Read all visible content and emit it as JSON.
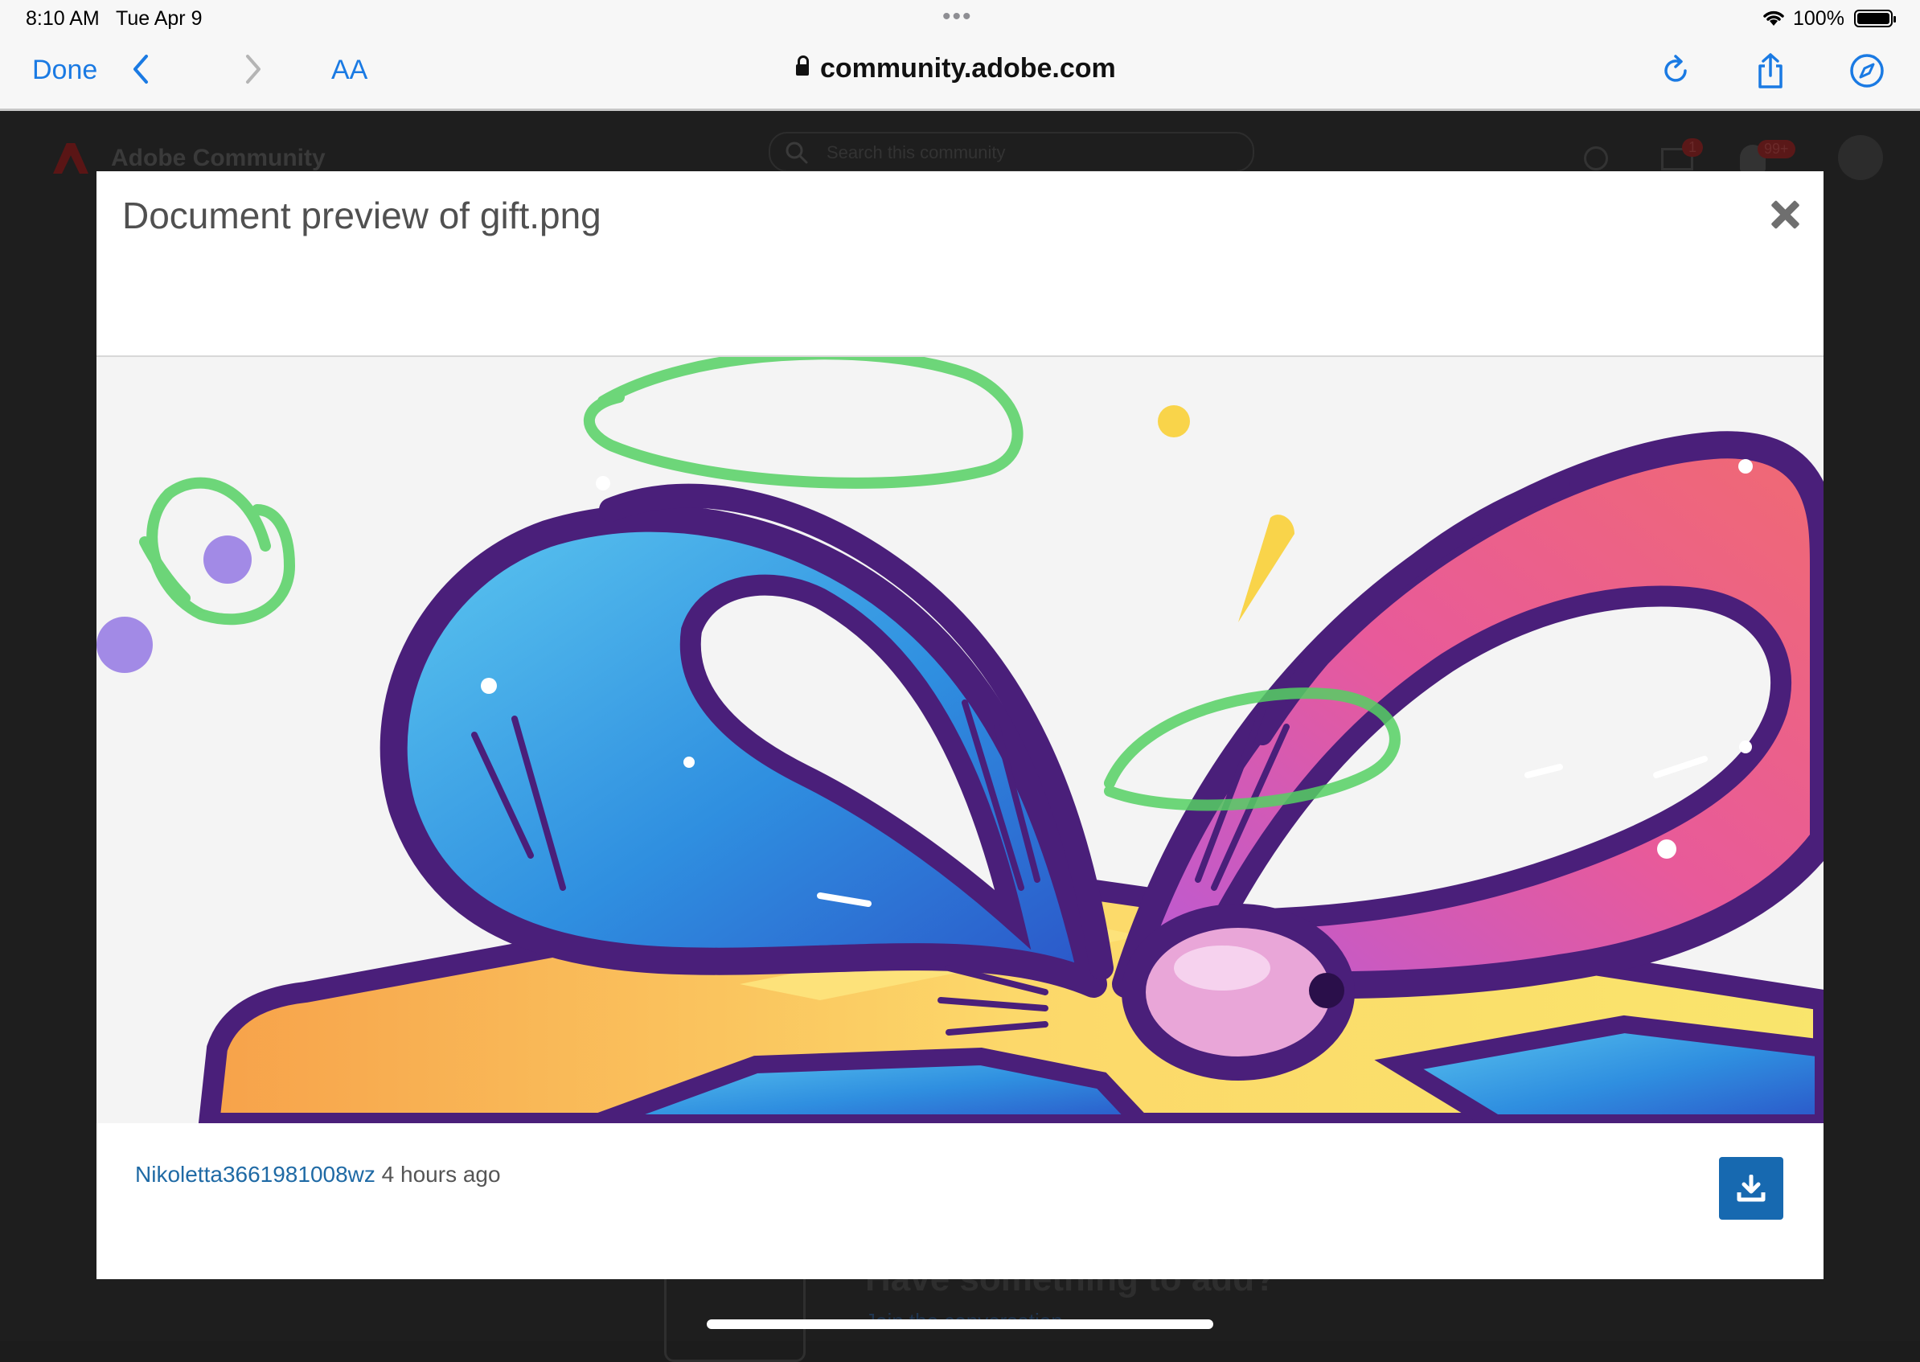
{
  "status_bar": {
    "time": "8:10 AM",
    "date": "Tue Apr 9",
    "battery": "100%"
  },
  "toolbar": {
    "done_label": "Done",
    "text_size_label": "AA",
    "url": "community.adobe.com",
    "icons": [
      "back-icon",
      "forward-icon",
      "reload-icon",
      "share-icon",
      "compass-icon"
    ]
  },
  "background_page": {
    "site_title": "Adobe Community",
    "search_placeholder": "Search this community",
    "mail_badge": "1",
    "notification_badge": "99+",
    "lower_title": "Have something to add?",
    "lower_link": "Join the conversation"
  },
  "modal": {
    "title": "Document preview of gift.png",
    "uploader": "Nikoletta3661981008wz",
    "uploaded_time": "4 hours ago",
    "download_icon": "download-icon",
    "close_icon": "close-icon"
  },
  "colors": {
    "link_blue": "#1a7ae3",
    "download_button": "#1769b0",
    "ribbon_outline": "#4a1f7a",
    "annotation_green": "#55d063"
  }
}
